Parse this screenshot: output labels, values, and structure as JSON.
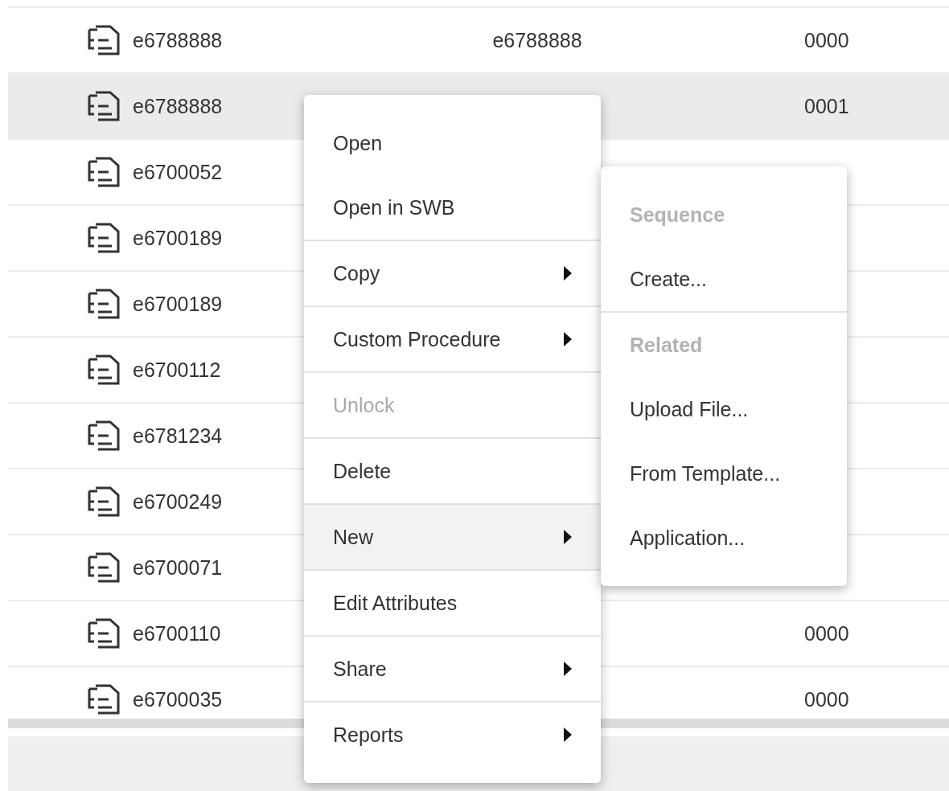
{
  "table": {
    "rows": [
      {
        "name": "e6788888",
        "column_2": "e6788888",
        "column_3": "0000",
        "selected": false
      },
      {
        "name": "e6788888",
        "column_3": "0001",
        "selected": true
      },
      {
        "name": "e6700052",
        "selected": false
      },
      {
        "name": "e6700189",
        "selected": false
      },
      {
        "name": "e6700189",
        "selected": false
      },
      {
        "name": "e6700112",
        "selected": false
      },
      {
        "name": "e6781234",
        "selected": false
      },
      {
        "name": "e6700249",
        "selected": false
      },
      {
        "name": "e6700071",
        "selected": false
      },
      {
        "name": "e6700110",
        "column_3": "0000",
        "selected": false
      },
      {
        "name": "e6700035",
        "column_3": "0000",
        "selected": false
      }
    ]
  },
  "context_menu": {
    "groups": [
      [
        {
          "label": "Open",
          "submenu": false,
          "disabled": false,
          "selected": false
        },
        {
          "label": "Open in SWB",
          "submenu": false,
          "disabled": false,
          "selected": false
        }
      ],
      [
        {
          "label": "Copy",
          "submenu": true,
          "disabled": false,
          "selected": false
        }
      ],
      [
        {
          "label": "Custom Procedure",
          "submenu": true,
          "disabled": false,
          "selected": false
        }
      ],
      [
        {
          "label": "Unlock",
          "submenu": false,
          "disabled": true,
          "selected": false
        }
      ],
      [
        {
          "label": "Delete",
          "submenu": false,
          "disabled": false,
          "selected": false
        }
      ],
      [
        {
          "label": "New",
          "submenu": true,
          "disabled": false,
          "selected": true
        }
      ],
      [
        {
          "label": "Edit Attributes",
          "submenu": false,
          "disabled": false,
          "selected": false
        }
      ],
      [
        {
          "label": "Share",
          "submenu": true,
          "disabled": false,
          "selected": false
        }
      ],
      [
        {
          "label": "Reports",
          "submenu": true,
          "disabled": false,
          "selected": false
        }
      ]
    ]
  },
  "submenu": {
    "sections": [
      {
        "header": "Sequence",
        "items": [
          "Create..."
        ]
      },
      {
        "header": "Related",
        "items": [
          "Upload File...",
          "From Template...",
          "Application..."
        ]
      }
    ]
  }
}
